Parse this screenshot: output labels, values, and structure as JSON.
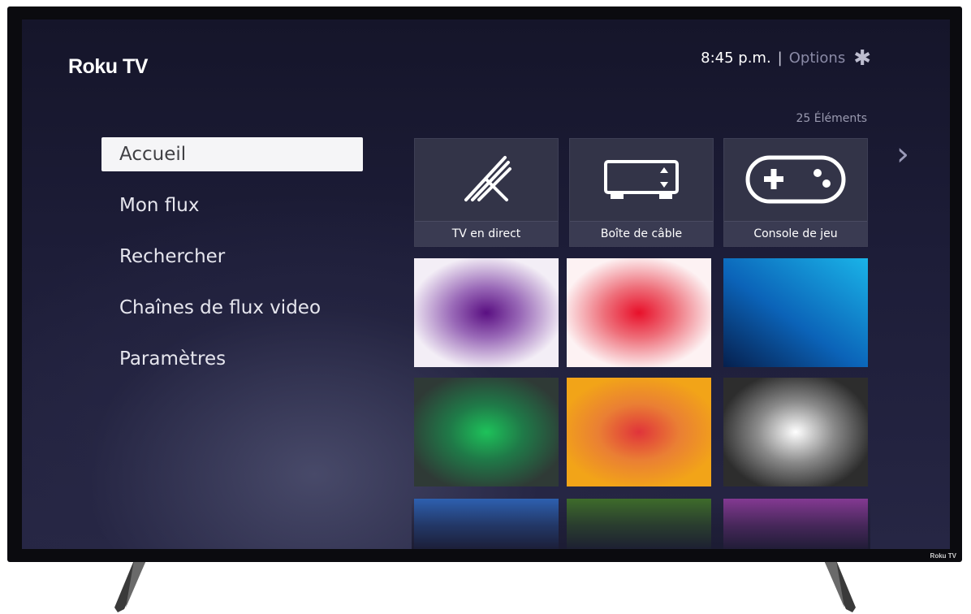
{
  "header": {
    "logo": "Roku TV",
    "time": "8:45 p.m.",
    "separator": "|",
    "options_label": "Options",
    "options_icon": "asterisk-icon",
    "item_count": "25 Éléments"
  },
  "menu": {
    "items": [
      {
        "label": "Accueil",
        "selected": true
      },
      {
        "label": "Mon flux",
        "selected": false
      },
      {
        "label": "Rechercher",
        "selected": false
      },
      {
        "label": "Chaînes de flux video",
        "selected": false
      },
      {
        "label": "Paramètres",
        "selected": false
      }
    ]
  },
  "tiles": {
    "devices": [
      {
        "label": "TV en direct",
        "icon": "antenna-icon"
      },
      {
        "label": "Boîte de câble",
        "icon": "cable-box-icon"
      },
      {
        "label": "Console de jeu",
        "icon": "gamepad-icon"
      }
    ],
    "channel_colors": [
      "#5a0f82",
      "#e8102a",
      "#0b63b8",
      "#1ec25a",
      "#e0343a",
      "#e6e6e6",
      "#2e62b4",
      "#3f6e2a",
      "#873a95"
    ]
  },
  "bezel_brand": "Roku TV",
  "next_icon": "chevron-right-icon"
}
